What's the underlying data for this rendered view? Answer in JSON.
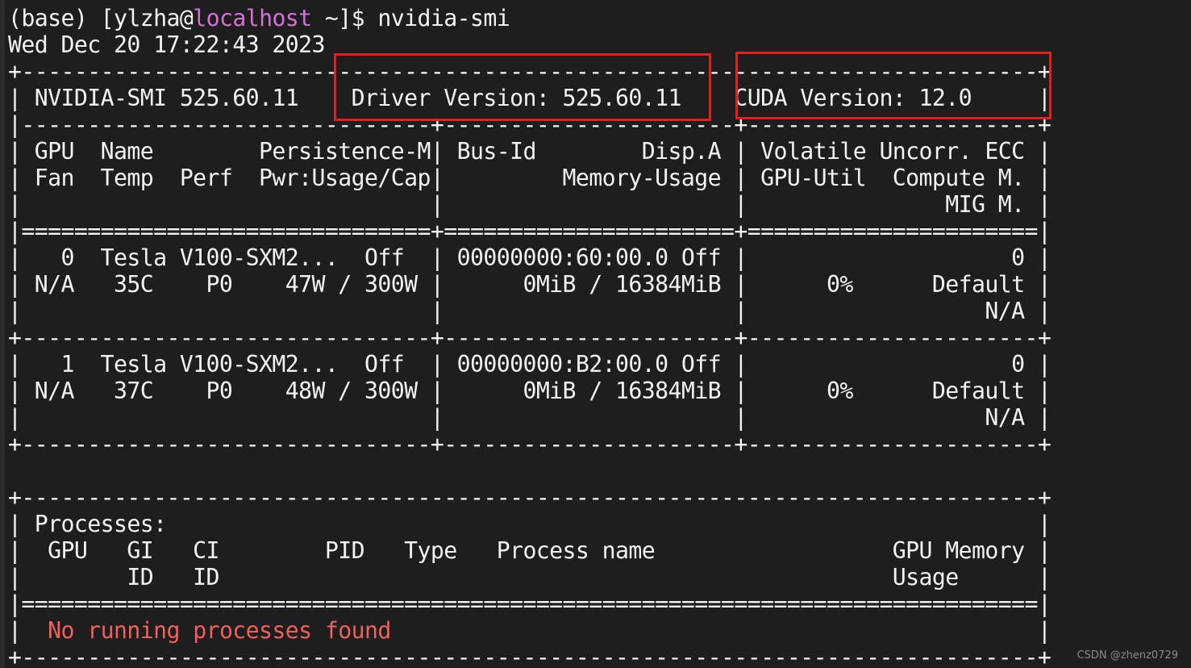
{
  "prompt": {
    "env": "(base)",
    "bracket_open": "[",
    "user": "ylzha@",
    "host": "localhost",
    "path_and_cmd": " ~]$ nvidia-smi"
  },
  "timestamp": "Wed Dec 20 17:22:43 2023",
  "smi_table": {
    "border_top": "+-----------------------------------------------------------------------------+",
    "header_line": "| NVIDIA-SMI 525.60.11    Driver Version: 525.60.11    CUDA Version: 12.0     |",
    "sep_dash": "|-------------------------------+----------------------+----------------------+",
    "col_header_1": "| GPU  Name        Persistence-M| Bus-Id        Disp.A | Volatile Uncorr. ECC |",
    "col_header_2": "| Fan  Temp  Perf  Pwr:Usage/Cap|         Memory-Usage | GPU-Util  Compute M. |",
    "col_header_3": "|                               |                      |               MIG M. |",
    "sep_equal": "|===============================+======================+======================|",
    "gpu0_line1": "|   0  Tesla V100-SXM2...  Off  | 00000000:60:00.0 Off |                    0 |",
    "gpu0_line2": "| N/A   35C    P0    47W / 300W |      0MiB / 16384MiB |      0%      Default |",
    "gpu0_line3": "|                               |                      |                  N/A |",
    "sep_plus": "+-------------------------------+----------------------+----------------------+",
    "gpu1_line1": "|   1  Tesla V100-SXM2...  Off  | 00000000:B2:00.0 Off |                    0 |",
    "gpu1_line2": "| N/A   37C    P0    48W / 300W |      0MiB / 16384MiB |      0%      Default |",
    "gpu1_line3": "|                               |                      |                  N/A |",
    "sep_plus_end": "+-------------------------------+----------------------+----------------------+"
  },
  "processes_table": {
    "border_top": "+-----------------------------------------------------------------------------+",
    "title_line": "| Processes:                                                                  |",
    "header_1": "|  GPU   GI   CI        PID   Type   Process name                  GPU Memory |",
    "header_2": "|        ID   ID                                                   Usage      |",
    "sep_equal": "|=============================================================================|",
    "row_prefix": "|  ",
    "no_process_text": "No running processes found",
    "row_suffix": "                                                 |",
    "border_bottom": "+-----------------------------------------------------------------------------+"
  },
  "watermark": "CSDN @zhenz0729",
  "colors": {
    "background": "#1e1e1e",
    "text": "#f2f2f2",
    "host": "#d670d6",
    "no_process": "#f0605c",
    "annotation_box": "#e0201c"
  }
}
